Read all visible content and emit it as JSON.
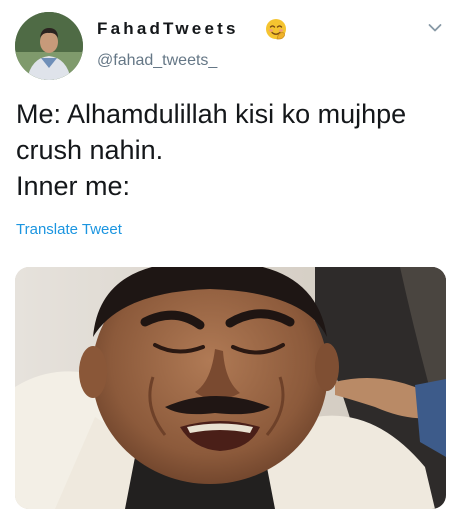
{
  "header": {
    "display_name": "FahadTweets",
    "emoji": "smiling-face-with-smiling-eyes-and-hand-covering-mouth",
    "handle": "@fahad_tweets_"
  },
  "tweet": {
    "lines": [
      "Me: Alhamdulillah kisi ko mujhpe",
      "crush nahin.",
      "Inner me:"
    ],
    "translate_label": "Translate Tweet"
  },
  "icons": {
    "menu": "chevron-down-icon",
    "avatar": "profile-avatar"
  },
  "colors": {
    "link": "#1b95e0",
    "handle": "#657786",
    "text": "#14171a"
  }
}
